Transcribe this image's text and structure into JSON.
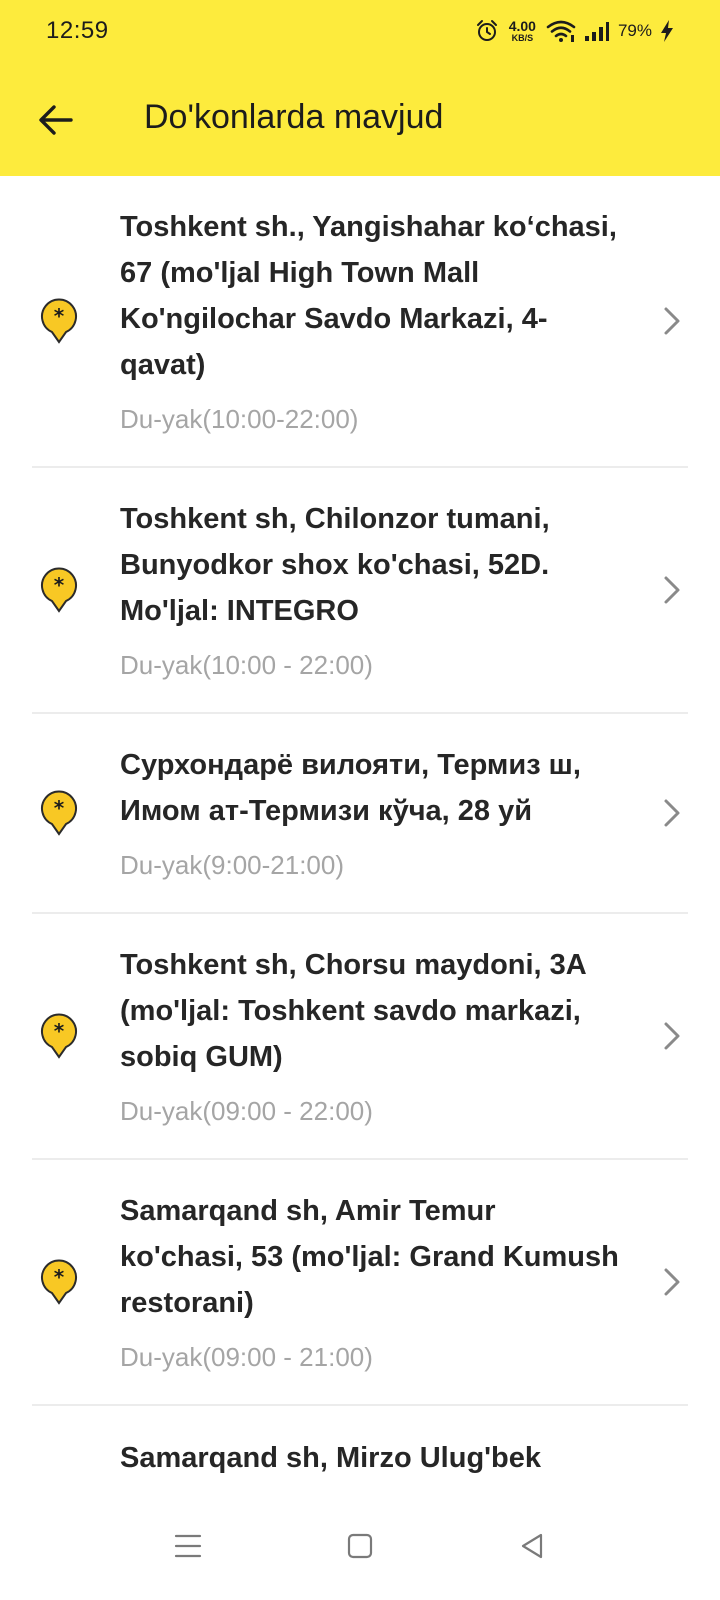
{
  "status_bar": {
    "time": "12:59",
    "network_speed_value": "4.00",
    "network_speed_unit": "KB/S",
    "battery_percent": "79%",
    "icons": [
      "alarm-icon",
      "wifi-icon",
      "cellular-signal-icon",
      "charging-bolt-icon"
    ]
  },
  "app_bar": {
    "title": "Do'konlarda mavjud",
    "back_icon": "back-arrow-icon"
  },
  "colors": {
    "header_bg": "#FDEB3D",
    "pin_fill": "#F8C824",
    "hours_text": "#a5a5a5"
  },
  "stores": [
    {
      "address": "Toshkent sh., Yangishahar ko‘chasi, 67 (mo'ljal High Town Mall Ko'ngilochar Savdo Markazi, 4-qavat)",
      "hours": "Du-yak(10:00-22:00)"
    },
    {
      "address": "Toshkent sh, Chilonzor tumani, Bunyodkor shox ko'chasi, 52D. Mo'ljal: INTEGRO",
      "hours": "Du-yak(10:00 - 22:00)"
    },
    {
      "address": "Сурхондарё вилояти, Термиз ш, Имом ат-Термизи кўча, 28 уй",
      "hours": "Du-yak(9:00-21:00)"
    },
    {
      "address": "Toshkent sh, Chorsu maydoni, 3A (mo'ljal: Toshkent savdo markazi, sobiq GUM)",
      "hours": "Du-yak(09:00 - 22:00)"
    },
    {
      "address": "Samarqand sh, Amir Temur ko'chasi, 53 (mo'ljal: Grand Kumush restorani)",
      "hours": "Du-yak(09:00 - 21:00)"
    }
  ],
  "partial_item": {
    "address": "Samarqand sh, Mirzo Ulug'bek"
  },
  "nav_bar": {
    "icons": [
      "menu-icon",
      "home-square-icon",
      "back-triangle-icon"
    ]
  }
}
